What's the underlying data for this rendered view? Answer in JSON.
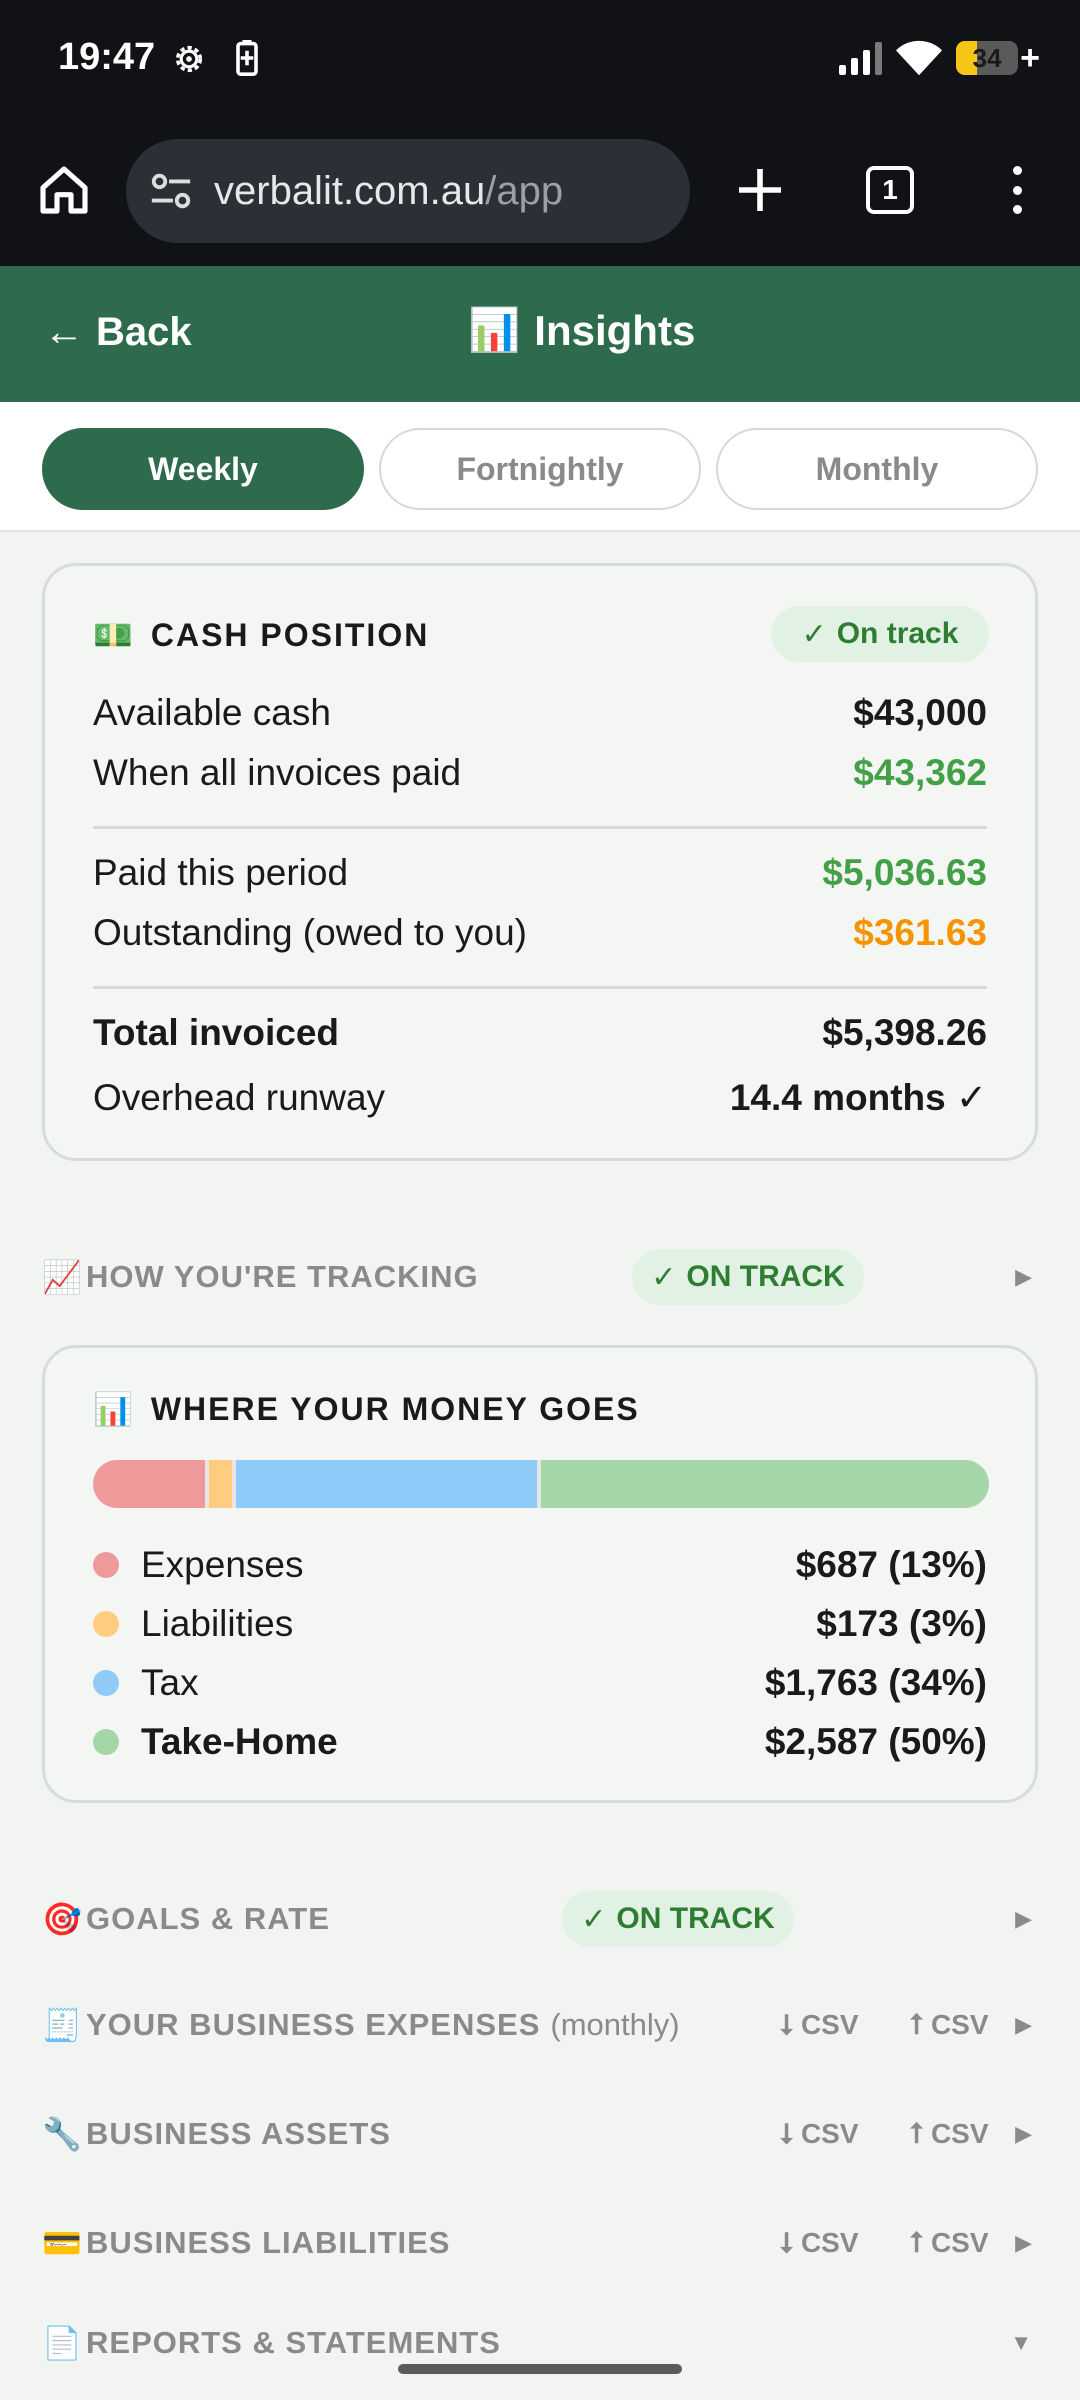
{
  "status_bar": {
    "time": "19:47",
    "battery": "34",
    "battery_charging": "+"
  },
  "browser": {
    "url_domain": "verbalit.com.au",
    "url_path": "/app",
    "tab_count": "1"
  },
  "header": {
    "back_label": "Back",
    "back_arrow": "←",
    "title": "Insights",
    "title_icon": "📊"
  },
  "period_tabs": [
    {
      "label": "Weekly",
      "active": true
    },
    {
      "label": "Fortnightly",
      "active": false
    },
    {
      "label": "Monthly",
      "active": false
    }
  ],
  "cash_position": {
    "icon": "💵",
    "title": "CASH POSITION",
    "status": "On track",
    "rows": [
      {
        "label": "Available cash",
        "value": "$43,000"
      },
      {
        "label": "When all invoices paid",
        "value": "$43,362"
      },
      {
        "label": "Paid this period",
        "value": "$5,036.63"
      },
      {
        "label": "Outstanding (owed to you)",
        "value": "$361.63"
      },
      {
        "label": "Total invoiced",
        "value": "$5,398.26"
      },
      {
        "label": "Overhead runway",
        "value": "14.4 months ✓"
      }
    ]
  },
  "tracking": {
    "icon": "📈",
    "label": "HOW YOU'RE TRACKING",
    "status": "ON TRACK"
  },
  "money": {
    "icon": "📊",
    "title": "WHERE YOUR MONEY GOES",
    "items": [
      {
        "name": "Expenses",
        "amount": "$687 (13%)",
        "percent": 13,
        "color": "#ef9a9a"
      },
      {
        "name": "Liabilities",
        "amount": "$173 (3%)",
        "percent": 3,
        "color": "#ffcc80"
      },
      {
        "name": "Tax",
        "amount": "$1,763 (34%)",
        "percent": 34,
        "color": "#90caf9"
      },
      {
        "name": "Take-Home",
        "amount": "$2,587 (50%)",
        "percent": 50,
        "color": "#a5d6a7"
      }
    ]
  },
  "goals": {
    "icon": "🎯",
    "label": "GOALS & RATE",
    "status": "ON TRACK"
  },
  "sections": [
    {
      "icon": "🧾",
      "label": "YOUR BUSINESS EXPENSES",
      "sub": "(monthly)",
      "download": "⭣ CSV",
      "upload": "⭡ CSV"
    },
    {
      "icon": "🔧",
      "label": "BUSINESS ASSETS",
      "sub": "",
      "download": "⭣ CSV",
      "upload": "⭡ CSV"
    },
    {
      "icon": "💳",
      "label": "BUSINESS LIABILITIES",
      "sub": "",
      "download": "⭣ CSV",
      "upload": "⭡ CSV"
    }
  ],
  "reports": {
    "icon": "📄",
    "label": "REPORTS & STATEMENTS"
  },
  "colors": {
    "brand_green": "#2e6b4c",
    "positive": "#43a047",
    "warning": "#f59400",
    "status_pill_bg": "#e1f1e4"
  }
}
